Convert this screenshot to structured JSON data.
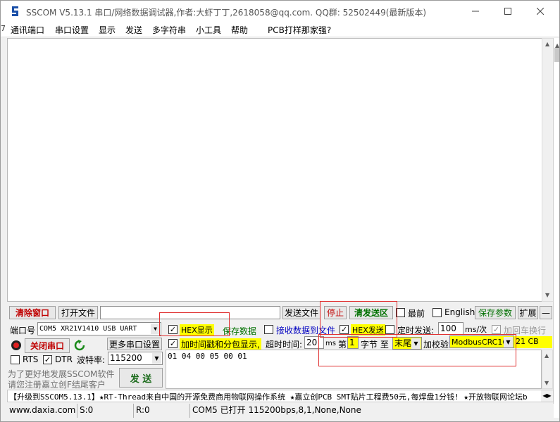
{
  "window": {
    "title": "SSCOM V5.13.1 串口/网络数据调试器,作者:大虾丁丁,2618058@qq.com. QQ群: 52502449(最新版本)",
    "edge_char": "7"
  },
  "menu": [
    "通讯端口",
    "串口设置",
    "显示",
    "发送",
    "多字符串",
    "小工具",
    "帮助",
    "PCB打样那家强?"
  ],
  "toolbar": {
    "clear_window": "清除窗口",
    "open_file": "打开文件",
    "file_path": "",
    "send_file": "发送文件",
    "stop": "停止",
    "clear_send": "清发送区",
    "topmost": "最前",
    "english": "English",
    "save_params": "保存参数",
    "expand": "扩展",
    "collapse": "—"
  },
  "port": {
    "label": "端口号",
    "value": "COM5 XR21V1410 USB UART",
    "hex_display": "HEX显示",
    "save_data": "保存数据",
    "recv_to_file": "接收数据到文件",
    "hex_send": "HEX发送",
    "timed_send": "定时发送:",
    "interval": "100",
    "interval_unit": "ms/次",
    "add_crlf": "加回车换行"
  },
  "row2": {
    "close_port": "关闭串口",
    "more_settings": "更多串口设置",
    "timestamp": "加时间戳和分包显示,",
    "timeout_label": "超时时间:",
    "timeout": "20",
    "timeout_unit": "ms",
    "byte_prefix": "第",
    "byte_index": "1",
    "byte_label": "字节 至",
    "byte_end": "末尾",
    "checksum_label": "加校验",
    "checksum_type": "ModbusCRC16",
    "checksum_value": "21 CB"
  },
  "row3": {
    "rts": "RTS",
    "dtr": "DTR",
    "baud_label": "波特率:",
    "baud": "115200",
    "send": "发  送",
    "send_data": "01 04 00 05 00 01"
  },
  "promo": {
    "line1": "为了更好地发展SSCOM软件",
    "line2": "请您注册嘉立创F结尾客户",
    "ticker": "【升级到SSCOM5.13.1】★RT-Thread来自中国的开源免费商用物联网操作系统 ★嘉立创PCB SMT贴片工程费50元,每焊盘1分钱! ★开放物联网论坛b"
  },
  "status": {
    "site": "www.daxia.com",
    "sent": "S:0",
    "recv": "R:0",
    "port_state": "COM5 已打开  115200bps,8,1,None,None"
  },
  "colors": {
    "red_text": "#c00000",
    "green_text": "#007000",
    "blue_text": "#0000c0",
    "highlight": "#ffff00",
    "annotation": "#e03030"
  }
}
